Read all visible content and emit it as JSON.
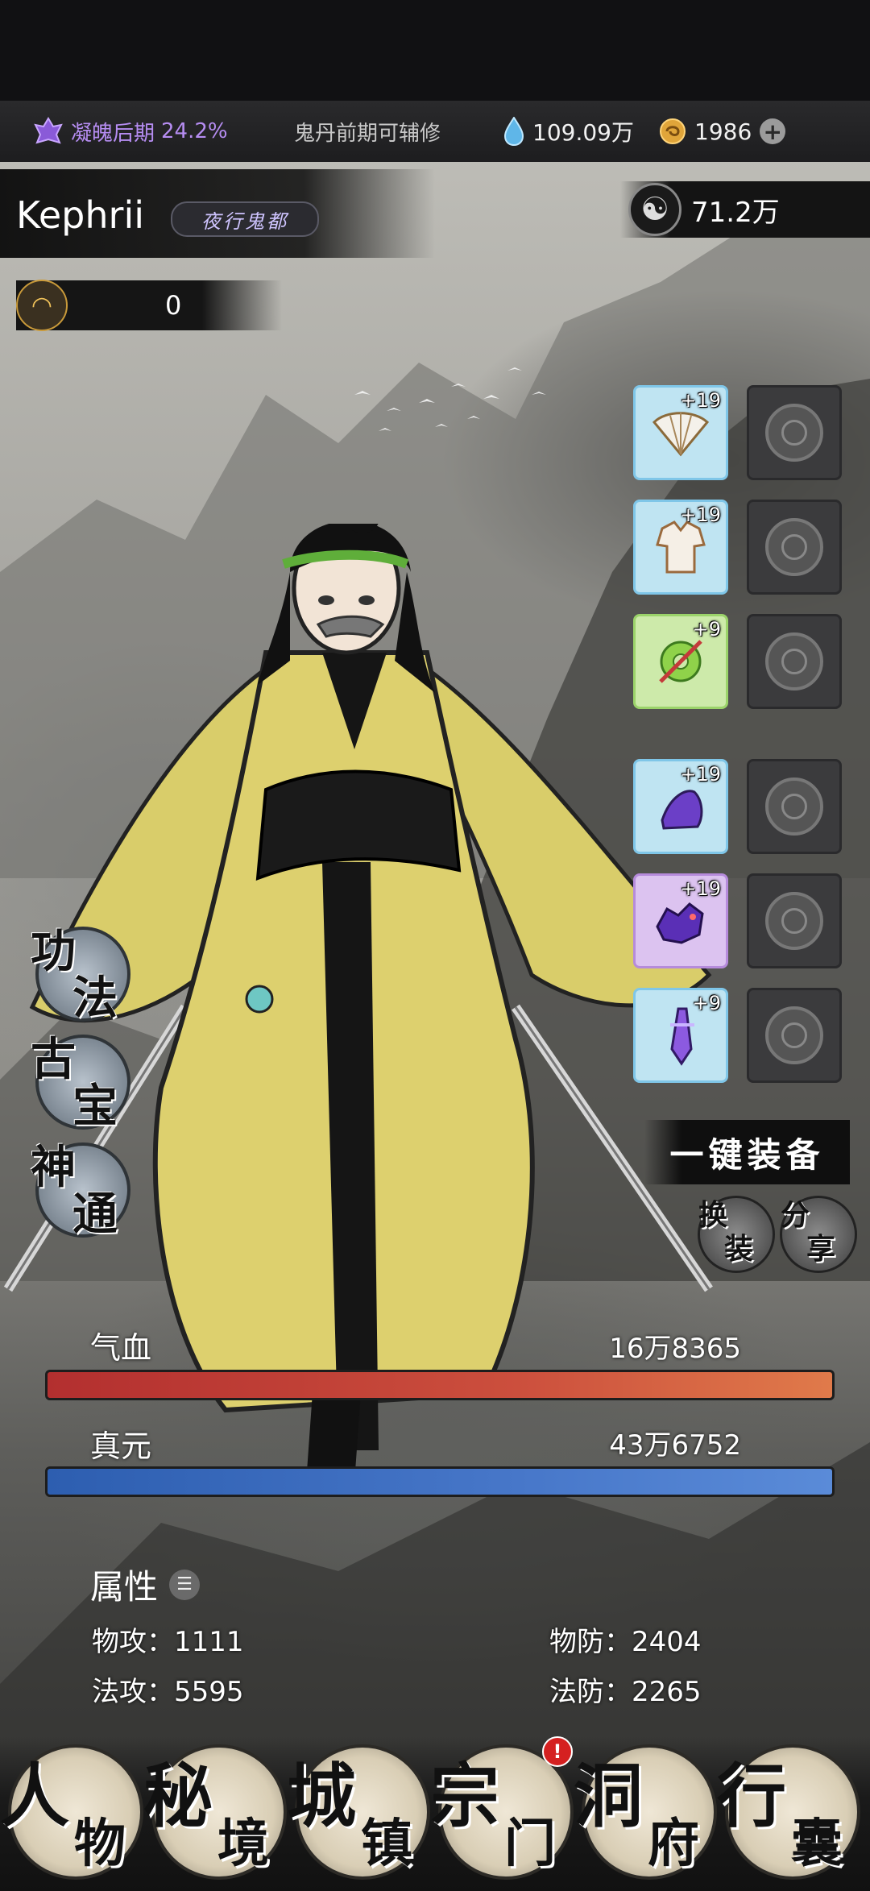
{
  "status": {
    "realm_name": "凝魄后期",
    "realm_progress": "24.2%",
    "hint": "鬼丹前期可辅修",
    "spirit_stones": "109.09万",
    "gold": "1986",
    "colors": {
      "realm": "#b68df2"
    }
  },
  "player": {
    "name": "Kephrii",
    "sect": "夜行鬼都",
    "power": "71.2万",
    "token_count": "0"
  },
  "equipment": [
    {
      "level": "+19",
      "icon": "fan-icon",
      "rarity": "blue"
    },
    {
      "level": "+19",
      "icon": "armor-icon",
      "rarity": "blue"
    },
    {
      "level": "+9",
      "icon": "jade-disc-icon",
      "rarity": "green"
    },
    {
      "level": "+19",
      "icon": "purple-boots-icon",
      "rarity": "blue"
    },
    {
      "level": "+19",
      "icon": "purple-beast-icon",
      "rarity": "purple"
    },
    {
      "level": "+9",
      "icon": "purple-sword-icon",
      "rarity": "blue"
    }
  ],
  "side_menu": {
    "gongfa": [
      "功",
      "法"
    ],
    "gubao": [
      "古",
      "宝"
    ],
    "shentong": [
      "神",
      "通"
    ]
  },
  "actions": {
    "equip_all": "一键装备",
    "change_outfit": [
      "换",
      "装"
    ],
    "share": [
      "分",
      "享"
    ]
  },
  "bars": {
    "hp_label": "气血",
    "hp_value": "16万8365",
    "mp_label": "真元",
    "mp_value": "43万6752"
  },
  "attributes": {
    "title": "属性",
    "phys_atk_label": "物攻：",
    "phys_atk": "1111",
    "phys_def_label": "物防：",
    "phys_def": "2404",
    "mag_atk_label": "法攻：",
    "mag_atk": "5595",
    "mag_def_label": "法防：",
    "mag_def": "2265"
  },
  "nav": [
    {
      "c1": "人",
      "c2": "物"
    },
    {
      "c1": "秘",
      "c2": "境"
    },
    {
      "c1": "城",
      "c2": "镇"
    },
    {
      "c1": "宗",
      "c2": "门"
    },
    {
      "c1": "洞",
      "c2": "府"
    },
    {
      "c1": "行",
      "c2": "囊"
    }
  ],
  "nav_alert": "!"
}
